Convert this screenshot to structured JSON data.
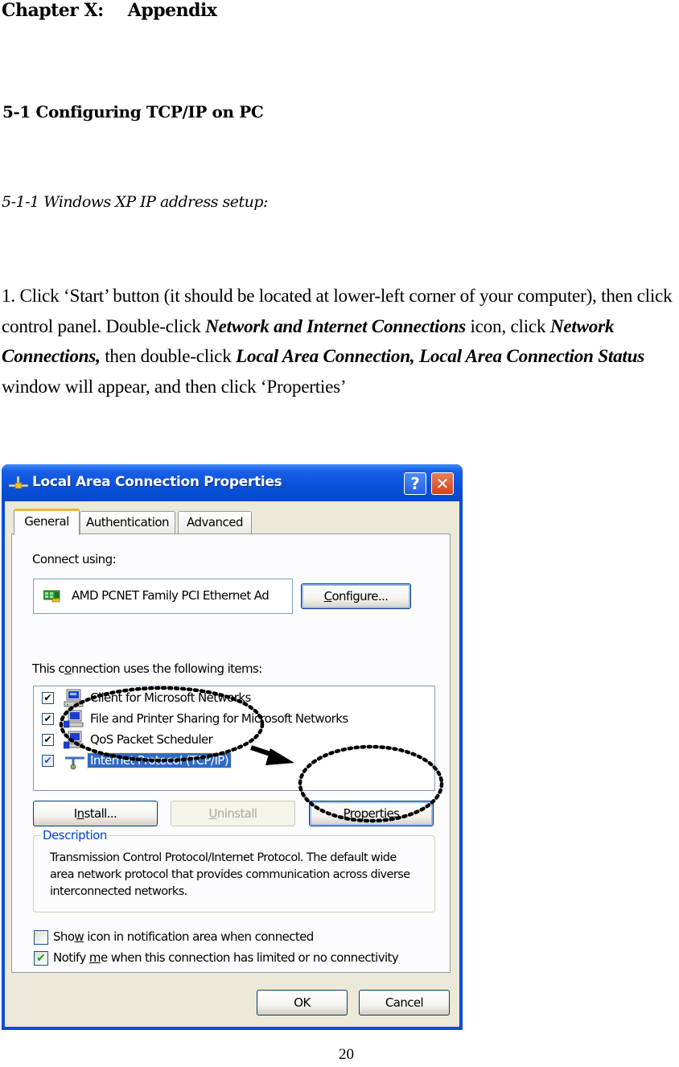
{
  "document": {
    "chapter_label": "Chapter X:",
    "chapter_title": "Appendix",
    "section_heading": "5-1 Configuring TCP/IP on PC",
    "subsection_heading": "5-1-1 Windows XP IP address setup:",
    "instruction": {
      "t1": "1. Click ‘Start’ button (it should be located at lower-left corner of your computer), then click control panel. Double-click ",
      "b1": "Network and Internet Connections",
      "t2": " icon, click ",
      "b2": "Network Connections,",
      "t3": " then double-click ",
      "b3": "Local Area Connection, Local Area Connection Status",
      "t4": " window will appear, and then click ‘Properties’"
    },
    "page_number": "20"
  },
  "dialog": {
    "title": "Local Area Connection Properties",
    "title_icon": "network-connection-icon",
    "help_glyph": "?",
    "close_glyph": "✕",
    "tabs": [
      {
        "label": "General",
        "active": true
      },
      {
        "label": "Authentication",
        "active": false
      },
      {
        "label": "Advanced",
        "active": false
      }
    ],
    "connect_using_label": "Connect using:",
    "adapter_name": "AMD PCNET Family PCI Ethernet Ad",
    "adapter_icon": "network-card-icon",
    "configure_button": {
      "accel": "C",
      "rest": "onfigure..."
    },
    "items_label": {
      "pre": "This c",
      "accel": "o",
      "post": "nnection uses the following items:"
    },
    "items": [
      {
        "label": "Client for Microsoft Networks",
        "checked": true,
        "icon": "computer-client-icon",
        "selected": false
      },
      {
        "label": "File and Printer Sharing for Microsoft Networks",
        "checked": true,
        "icon": "file-printer-sharing-icon",
        "selected": false
      },
      {
        "label": "QoS Packet Scheduler",
        "checked": true,
        "icon": "qos-scheduler-icon",
        "selected": false
      },
      {
        "label": "Internet Protocol (TCP/IP)",
        "checked": true,
        "icon": "network-protocol-icon",
        "selected": true
      }
    ],
    "install_button": {
      "pre": "I",
      "accel": "n",
      "post": "stall..."
    },
    "uninstall_button": {
      "accel": "U",
      "rest": "ninstall",
      "enabled": false
    },
    "properties_button": {
      "pre": "P",
      "accel": "r",
      "post": "operties"
    },
    "description_legend": "Description",
    "description_text": "Transmission Control Protocol/Internet Protocol. The default wide area network protocol that provides communication across diverse interconnected networks.",
    "show_icon_option": {
      "pre": "Sho",
      "accel": "w",
      "post": " icon in notification area when connected",
      "checked": false
    },
    "notify_option": {
      "pre": "Notify ",
      "accel": "m",
      "post": "e when this connection has limited or no connectivity",
      "checked": true
    },
    "ok_button": "OK",
    "cancel_button": "Cancel",
    "check_glyph": "✔"
  },
  "annotations": {
    "highlight_1": "ellipse around Internet Protocol (TCP/IP)",
    "highlight_2": "ellipse around Properties button",
    "arrow": "arrow from TCP/IP to Properties"
  },
  "colors": {
    "titlebar": "#0a52dc",
    "dialog_face": "#ece9d8",
    "selection": "#316ac5",
    "group_legend": "#0046d5",
    "active_tab_accent": "#f4b43a"
  }
}
